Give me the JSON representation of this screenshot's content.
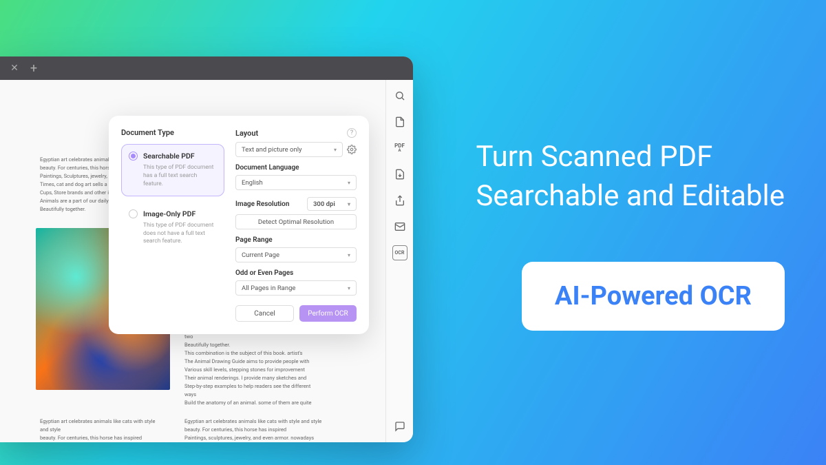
{
  "hero": {
    "line1": "Turn Scanned PDF",
    "line2": "Searchable and Editable",
    "badge": "AI-Powered OCR"
  },
  "dialog": {
    "docTypeTitle": "Document Type",
    "options": {
      "searchable": {
        "label": "Searchable PDF",
        "desc": "This type of PDF document has a full text search feature."
      },
      "imageOnly": {
        "label": "Image-Only PDF",
        "desc": "This type of PDF document does not have a full text search feature."
      }
    },
    "layoutLabel": "Layout",
    "layoutValue": "Text and picture only",
    "langLabel": "Document Language",
    "langValue": "English",
    "resLabel": "Image Resolution",
    "resValue": "300 dpi",
    "detectBtn": "Detect Optimal Resolution",
    "rangeLabel": "Page Range",
    "rangeValue": "Current Page",
    "oddEvenLabel": "Odd or Even Pages",
    "oddEvenValue": "All Pages in Range",
    "cancelBtn": "Cancel",
    "performBtn": "Perform OCR"
  },
  "document": {
    "para1": "Egyptian art celebrates animals\nbeauty. For centuries, this hors\nPaintings, Sculptures, jewelry,\nTimes, cat and dog art sells a l\nCups, Store brands and other i\nAnimals are a part of our daily\nBeautifully together.",
    "para2": "Animals are a part of our daily life, the combination of the two\nBeautifully together.\nThis combination is the subject of this book. artist's\nThe Animal Drawing Guide aims to provide people with\nVarious skill levels, stepping stones for improvement\nTheir animal renderings. I provide many sketches and\nStep-by-step examples to help readers see the different ways\nBuild the anatomy of an animal. some of them are quite",
    "para3": "Egyptian art celebrates animals like cats with style and style\nbeauty. For centuries, this horse has inspired\nPaintings, sculptures, jewelry, and even armor. nowadays",
    "para4": "Egyptian art celebrates animals like cats with style and style\nbeauty. For centuries, this horse has inspired\nPaintings, sculptures, jewelry, and even armor. nowadays"
  },
  "sidebar": {
    "ocrLabel": "OCR"
  }
}
